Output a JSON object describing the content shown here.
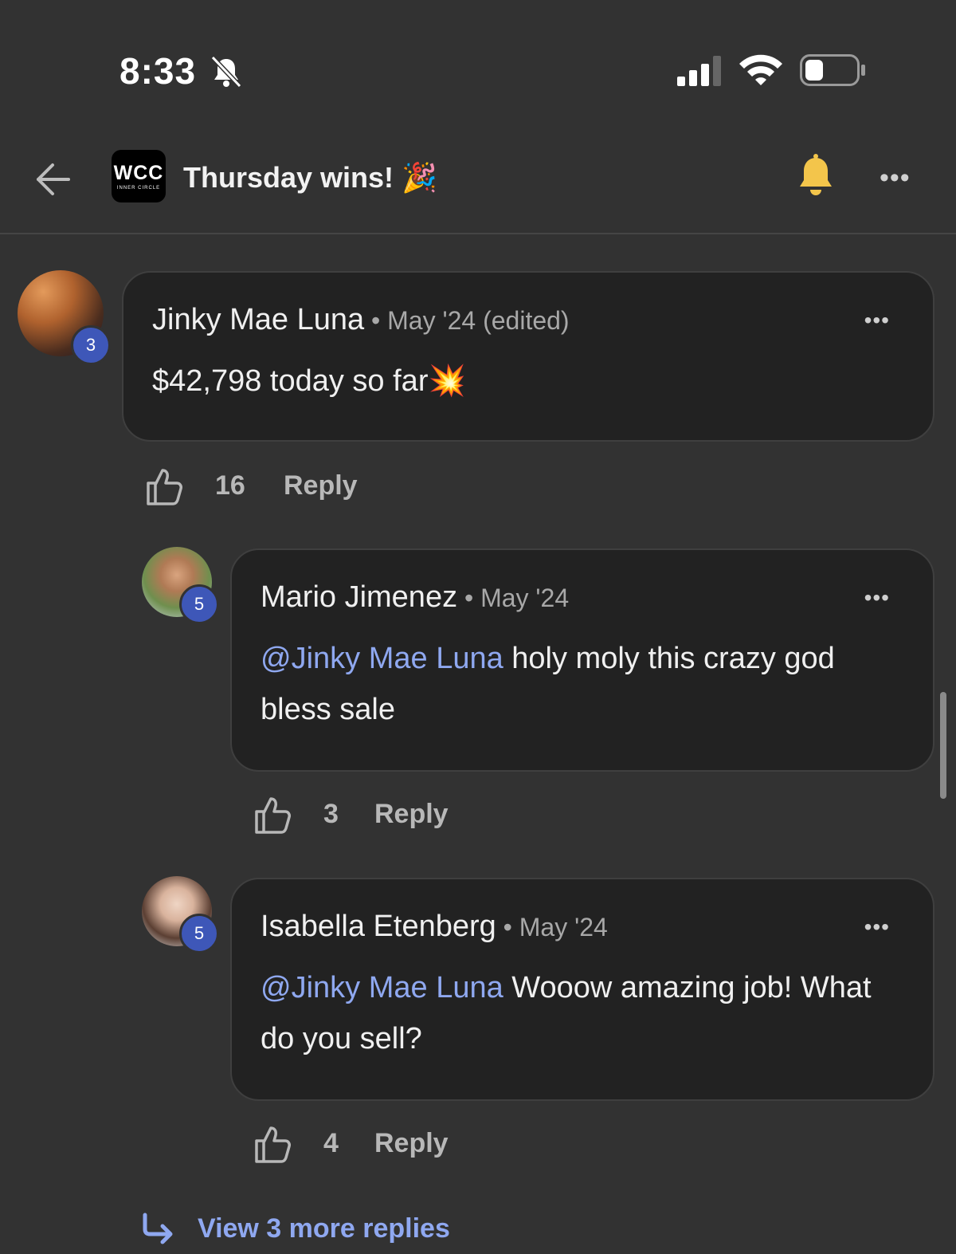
{
  "status_bar": {
    "time": "8:33"
  },
  "header": {
    "group_logo": "WCC",
    "group_logo_sub": "INNER CIRCLE",
    "title": "Thursday wins! 🎉"
  },
  "comments": [
    {
      "author": "Jinky Mae Luna",
      "meta": " • May '24 (edited)",
      "level": "3",
      "text": "$42,798 today so far💥",
      "likes": "16",
      "reply_label": "Reply"
    },
    {
      "author": "Mario Jimenez",
      "meta": " • May '24",
      "level": "5",
      "mention": "@Jinky Mae Luna",
      "text": " holy moly this crazy god bless sale",
      "likes": "3",
      "reply_label": "Reply"
    },
    {
      "author": "Isabella Etenberg",
      "meta": " • May '24",
      "level": "5",
      "mention": "@Jinky Mae Luna",
      "text": " Wooow amazing job! What do you sell?",
      "likes": "4",
      "reply_label": "Reply"
    }
  ],
  "view_more_label": "View 3 more replies",
  "colors": {
    "background": "#323232",
    "bubble": "#222222",
    "accent": "#8fa8f0",
    "level_badge": "#3e57b8",
    "bell": "#f3c54b"
  },
  "icons": [
    "bell-slash-icon",
    "signal-icon",
    "wifi-icon",
    "battery-icon",
    "back-arrow-icon",
    "bell-icon",
    "more-icon",
    "thumbs-up-icon",
    "reply-arrow-icon"
  ]
}
